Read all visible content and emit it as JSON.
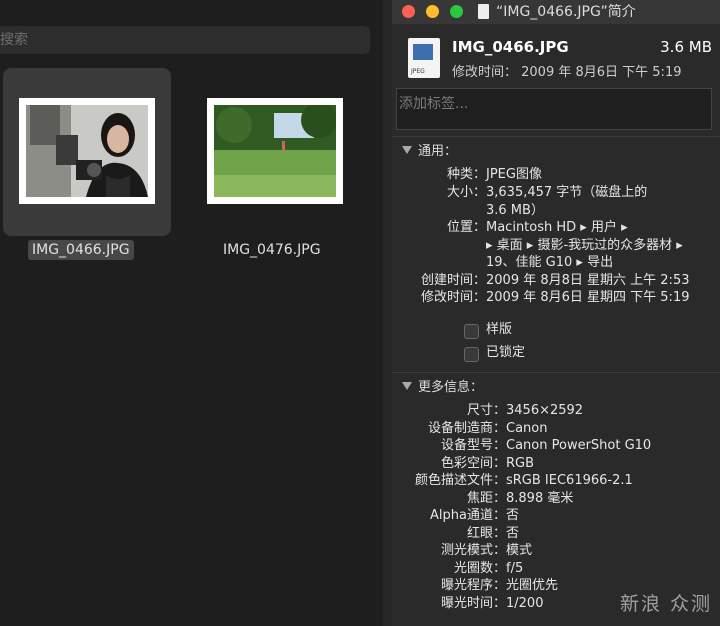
{
  "finder": {
    "search_placeholder": "搜索",
    "files": [
      {
        "name": "IMG_0466.JPG",
        "selected": true
      },
      {
        "name": "IMG_0476.JPG",
        "selected": false
      }
    ]
  },
  "info": {
    "window_title": "“IMG_0466.JPG”简介",
    "file_name": "IMG_0466.JPG",
    "file_size": "3.6 MB",
    "modified_line": "修改时间： 2009 年 8月6日 下午 5:19",
    "icon_label": "JPEG",
    "tags_placeholder": "添加标签...",
    "general": {
      "header": "通用：",
      "rows": [
        {
          "key": "种类：",
          "value": "JPEG图像"
        },
        {
          "key": "大小：",
          "value": "3,635,457 字节（磁盘上的"
        },
        {
          "key": "",
          "value": "3.6 MB）"
        },
        {
          "key": "位置：",
          "value": "Macintosh HD ▸ 用户 ▸"
        },
        {
          "key": "",
          "value": "▸ 桌面 ▸ 摄影-我玩过的众多器材 ▸"
        },
        {
          "key": "",
          "value": "19、佳能 G10 ▸ 导出"
        },
        {
          "key": "创建时间：",
          "value": "2009 年 8月8日 星期六 上午 2:53"
        },
        {
          "key": "修改时间：",
          "value": "2009 年 8月6日 星期四 下午 5:19"
        }
      ],
      "stationery_label": "样版",
      "locked_label": "已锁定"
    },
    "more": {
      "header": "更多信息：",
      "rows": [
        {
          "key": "尺寸：",
          "value": "3456×2592"
        },
        {
          "key": "设备制造商：",
          "value": "Canon"
        },
        {
          "key": "设备型号：",
          "value": "Canon PowerShot G10"
        },
        {
          "key": "色彩空间：",
          "value": "RGB"
        },
        {
          "key": "颜色描述文件：",
          "value": "sRGB IEC61966-2.1"
        },
        {
          "key": "焦距：",
          "value": "8.898 毫米"
        },
        {
          "key": "Alpha通道：",
          "value": "否"
        },
        {
          "key": "红眼：",
          "value": "否"
        },
        {
          "key": "测光模式：",
          "value": "模式"
        },
        {
          "key": "光圈数：",
          "value": "f/5"
        },
        {
          "key": "曝光程序：",
          "value": "光圈优先"
        },
        {
          "key": "曝光时间：",
          "value": "1/200"
        }
      ]
    }
  },
  "watermark": "新浪 众测",
  "colors": {
    "close": "#fe5f57",
    "minimize": "#febc2e",
    "zoom": "#28c840"
  }
}
